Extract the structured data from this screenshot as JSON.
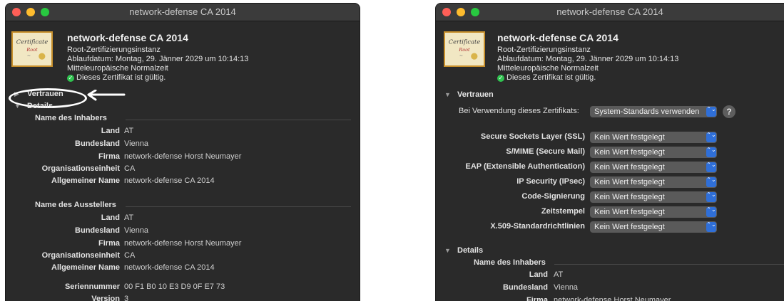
{
  "windows": [
    {
      "title": "network-defense CA 2014",
      "cert_icon_text": [
        "Certificate",
        "Root",
        "~"
      ],
      "cert_name": "network-defense CA 2014",
      "cert_type": "Root-Zertifizierungsinstanz",
      "expiry": "Ablaufdatum: Montag, 29. Jänner 2029 um 10:14:13",
      "timezone": "Mitteleuropäische Normalzeit",
      "valid_text": "Dieses Zertifikat ist gültig.",
      "trust_label": "Vertrauen",
      "details_label": "Details",
      "subject_heading": "Name des Inhabers",
      "subject": [
        {
          "k": "Land",
          "v": "AT"
        },
        {
          "k": "Bundesland",
          "v": "Vienna"
        },
        {
          "k": "Firma",
          "v": "network-defense Horst Neumayer"
        },
        {
          "k": "Organisationseinheit",
          "v": "CA"
        },
        {
          "k": "Allgemeiner Name",
          "v": "network-defense CA 2014"
        }
      ],
      "issuer_heading": "Name des Ausstellers",
      "issuer": [
        {
          "k": "Land",
          "v": "AT"
        },
        {
          "k": "Bundesland",
          "v": "Vienna"
        },
        {
          "k": "Firma",
          "v": "network-defense Horst Neumayer"
        },
        {
          "k": "Organisationseinheit",
          "v": "CA"
        },
        {
          "k": "Allgemeiner Name",
          "v": "network-defense CA 2014"
        }
      ],
      "extra": [
        {
          "k": "Seriennummer",
          "v": "00 F1 B0 10 E3 D9 0F E7 73"
        },
        {
          "k": "Version",
          "v": "3"
        }
      ]
    },
    {
      "title": "network-defense CA 2014",
      "cert_icon_text": [
        "Certificate",
        "Root",
        "~"
      ],
      "cert_name": "network-defense CA 2014",
      "cert_type": "Root-Zertifizierungsinstanz",
      "expiry": "Ablaufdatum: Montag, 29. Jänner 2029 um 10:14:13",
      "timezone": "Mitteleuropäische Normalzeit",
      "valid_text": "Dieses Zertifikat ist gültig.",
      "trust_label": "Vertrauen",
      "usage_label": "Bei Verwendung dieses Zertifikats:",
      "usage_value": "System-Standards verwenden",
      "help_label": "?",
      "stepper_glyph": "⌃⌄",
      "policies": [
        {
          "k": "Secure Sockets Layer (SSL)",
          "v": "Kein Wert festgelegt"
        },
        {
          "k": "S/MIME (Secure Mail)",
          "v": "Kein Wert festgelegt"
        },
        {
          "k": "EAP (Extensible Authentication)",
          "v": "Kein Wert festgelegt"
        },
        {
          "k": "IP Security (IPsec)",
          "v": "Kein Wert festgelegt"
        },
        {
          "k": "Code-Signierung",
          "v": "Kein Wert festgelegt"
        },
        {
          "k": "Zeitstempel",
          "v": "Kein Wert festgelegt"
        },
        {
          "k": "X.509-Standardrichtlinien",
          "v": "Kein Wert festgelegt"
        }
      ],
      "details_label": "Details",
      "subject_heading": "Name des Inhabers",
      "subject": [
        {
          "k": "Land",
          "v": "AT"
        },
        {
          "k": "Bundesland",
          "v": "Vienna"
        },
        {
          "k": "Firma",
          "v": "network-defense Horst Neumayer"
        }
      ]
    }
  ],
  "colors": {
    "window_bg": "#2a2a2a",
    "titlebar_bg": "#3b3b3b",
    "accent_blue": "#2f6fd8",
    "valid_green": "#30c350",
    "annotation": "#ffffff"
  }
}
